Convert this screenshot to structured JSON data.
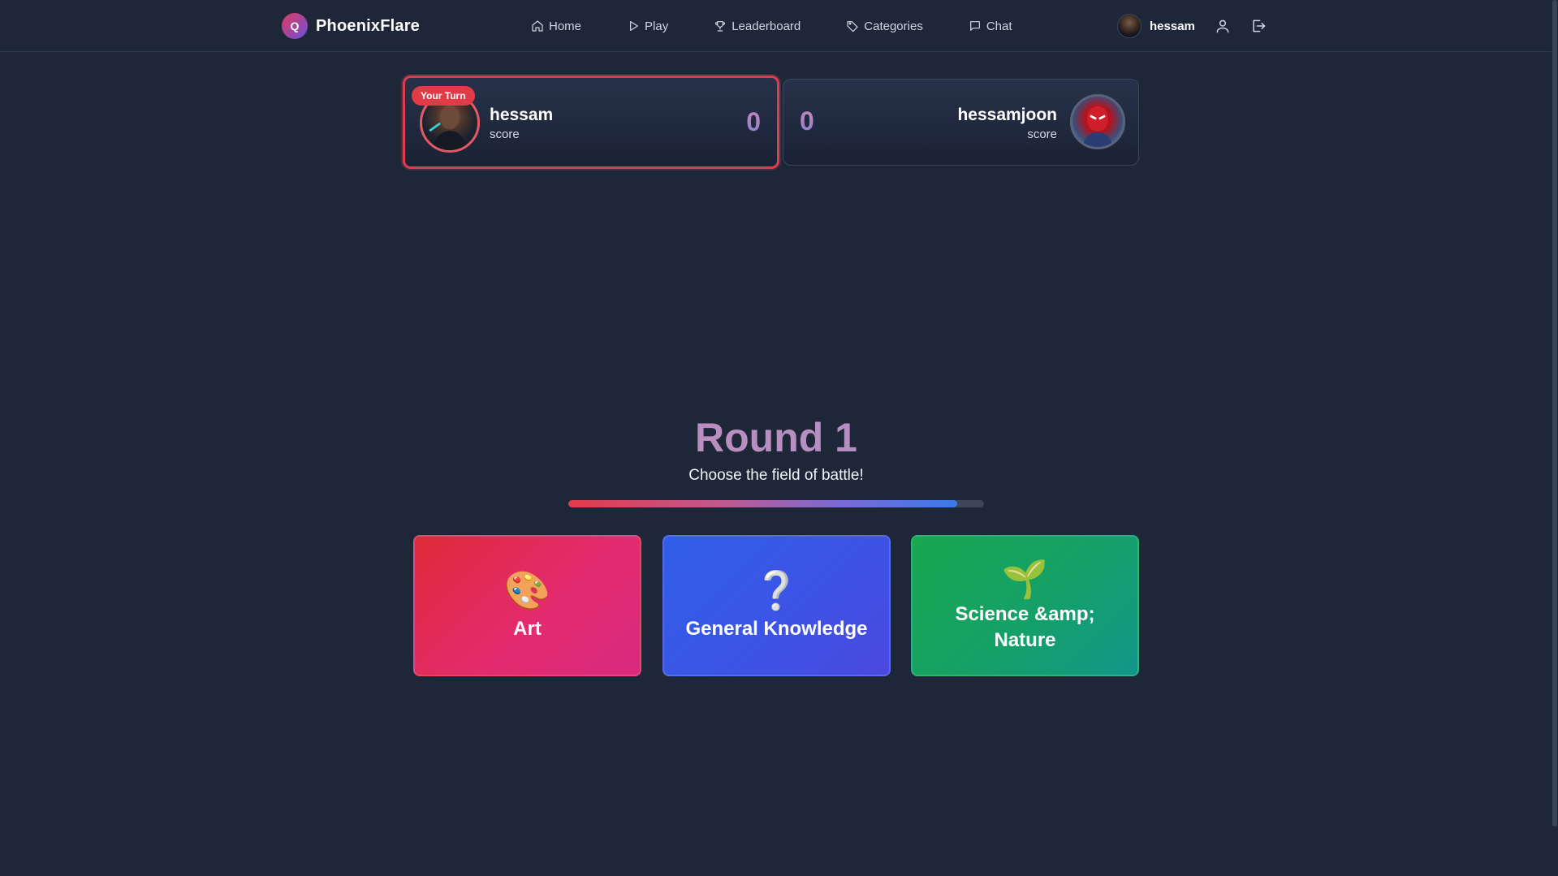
{
  "app": {
    "brand_logo_letter": "Q",
    "brand_name": "PhoenixFlare"
  },
  "nav": {
    "items": [
      {
        "label": "Home",
        "icon": "home-icon"
      },
      {
        "label": "Play",
        "icon": "play-icon"
      },
      {
        "label": "Leaderboard",
        "icon": "trophy-icon"
      },
      {
        "label": "Categories",
        "icon": "tag-icon"
      },
      {
        "label": "Chat",
        "icon": "chat-icon"
      }
    ]
  },
  "user": {
    "name": "hessam"
  },
  "players": {
    "me": {
      "name": "hessam",
      "label": "score",
      "score": "0",
      "turn_badge": "Your Turn"
    },
    "opponent": {
      "name": "hessamjoon",
      "label": "score",
      "score": "0"
    }
  },
  "round": {
    "title": "Round 1",
    "subtitle": "Choose the field of battle!",
    "timer_fraction": 0.936
  },
  "categories": [
    {
      "label": "Art",
      "emoji": "🎨"
    },
    {
      "label": "General Knowledge",
      "emoji": "❔"
    },
    {
      "label": "Science &amp; Nature",
      "emoji": "🌱"
    }
  ],
  "colors": {
    "background": "#1e2738",
    "accent_red": "#e23b48",
    "art": "#e02a58",
    "general_knowledge": "#3b55e6",
    "science_nature": "#15a068"
  }
}
